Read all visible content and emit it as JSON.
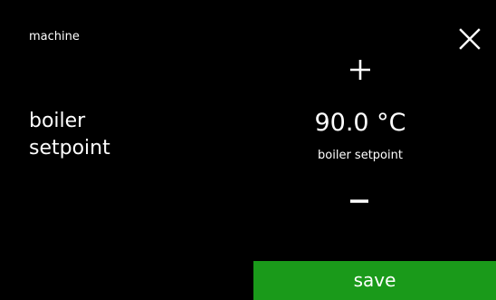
{
  "header": {
    "breadcrumb": "machine",
    "close_icon": "close-icon"
  },
  "parameter": {
    "label_line1": "boiler",
    "label_line2": "setpoint",
    "value": "90.0 °C",
    "caption": "boiler setpoint",
    "increase_icon": "plus-icon",
    "decrease_icon": "minus-icon"
  },
  "actions": {
    "save_label": "save"
  },
  "colors": {
    "background": "#000000",
    "text": "#ffffff",
    "save_button": "#1a9a1a"
  }
}
